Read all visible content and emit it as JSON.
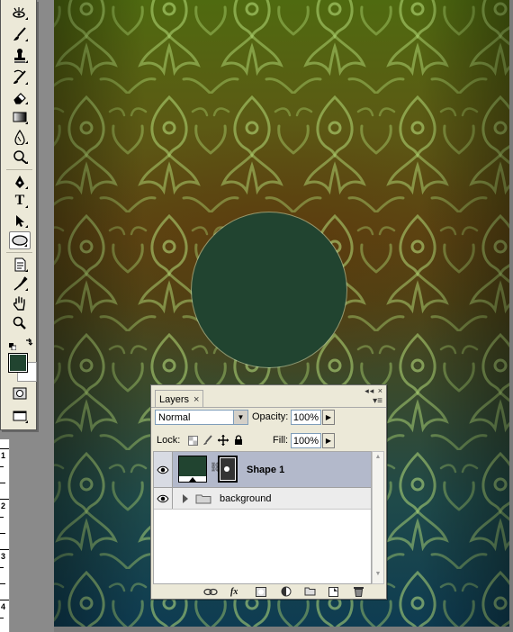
{
  "layers_panel": {
    "tab_label": "Layers",
    "close_glyph": "×",
    "mini_buttons": "◂◂ ×",
    "menu_glyph": "▾≡",
    "blend_mode": "Normal",
    "opacity_label": "Opacity:",
    "opacity_value": "100%",
    "lock_label": "Lock:",
    "fill_label": "Fill:",
    "fill_value": "100%",
    "layers": [
      {
        "name": "Shape 1",
        "selected": true,
        "visible": true,
        "kind": "shape"
      },
      {
        "name": "background",
        "selected": false,
        "visible": true,
        "kind": "group"
      }
    ],
    "footer_icons": [
      "link-icon",
      "fx-icon",
      "mask-icon",
      "adjustment-icon",
      "folder-icon",
      "new-layer-icon",
      "trash-icon"
    ],
    "fx_label": "fx"
  },
  "tools_palette": {
    "selected_tool": "ellipse-tool",
    "text_tool_glyph": "T"
  },
  "colors": {
    "foreground": "#214430",
    "background": "#ffffff",
    "circle_fill": "#214430",
    "selection_highlight": "#b3b9cb"
  },
  "ruler": {
    "labels": [
      "1",
      "2",
      "3",
      "4"
    ]
  }
}
